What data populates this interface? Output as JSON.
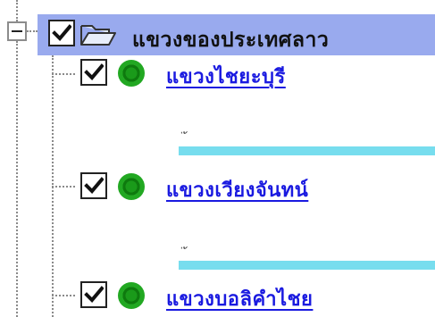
{
  "tree": {
    "root": {
      "label": "แขวงของประเทศลาว",
      "checked": true,
      "expanded": true,
      "icon": "folder-open-icon"
    },
    "items": [
      {
        "label": "แขวงไชยะบุรี",
        "checked": true,
        "icon": "green-circle-icon",
        "marks": "่ ้"
      },
      {
        "label": "แขวงเวียงจันทน์",
        "checked": true,
        "icon": "green-circle-icon",
        "marks": "่ ้"
      },
      {
        "label": "แขวงบอลิคำไชย",
        "checked": true,
        "icon": "green-circle-icon"
      }
    ]
  },
  "colors": {
    "selection": "#99aaee",
    "link": "#1a1ae0",
    "progress": "#77ddee",
    "status_dot": "#1a9a1a"
  }
}
